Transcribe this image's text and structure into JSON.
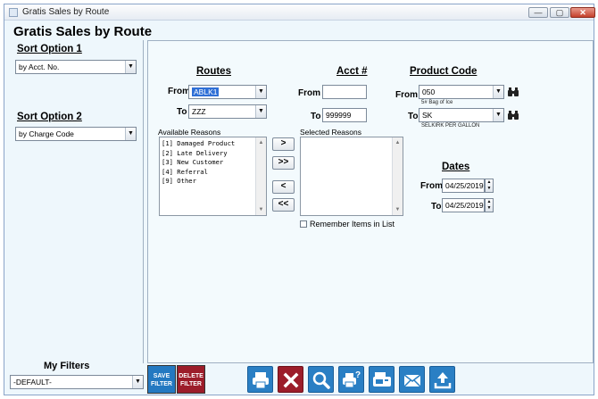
{
  "window": {
    "title": "Gratis Sales by Route",
    "minimize": "—",
    "maximize": "▢",
    "close": "✕"
  },
  "heading": "Gratis Sales by Route",
  "sort1": {
    "label": "Sort Option 1",
    "value": "by Acct. No."
  },
  "sort2": {
    "label": "Sort Option 2",
    "value": "by Charge Code"
  },
  "routes": {
    "label": "Routes",
    "from_label": "From",
    "from_value": "ABLK1",
    "to_label": "To",
    "to_value": "ZZZ"
  },
  "acct": {
    "label": "Acct #",
    "from_label": "From",
    "from_value": "",
    "to_label": "To",
    "to_value": "999999"
  },
  "product": {
    "label": "Product Code",
    "from_label": "From",
    "from_value": "050",
    "from_desc": "5# Bag of Ice",
    "to_label": "To",
    "to_value": "SK",
    "to_desc": "SELKIRK PER GALLON"
  },
  "reasons": {
    "available_label": "Available Reasons",
    "selected_label": "Selected Reasons",
    "available": [
      "[1] Damaged Product",
      "[2] Late Delivery",
      "[3] New Customer",
      "[4] Referral",
      "[9] Other"
    ],
    "add_one": ">",
    "add_all": ">>",
    "remove_one": "<",
    "remove_all": "<<",
    "remember_label": "Remember Items in List"
  },
  "dates": {
    "label": "Dates",
    "from_label": "From",
    "from_value": "04/25/2019",
    "to_label": "To",
    "to_value": "04/25/2019"
  },
  "filters": {
    "label": "My Filters",
    "value": "-DEFAULT-",
    "save_label": "SAVE FILTER",
    "delete_label": "DELETE FILTER"
  },
  "icons": [
    "printer-icon",
    "close-x-icon",
    "magnifier-icon",
    "print-help-icon",
    "fax-icon",
    "email-icon",
    "upload-icon"
  ],
  "colors": {
    "accent_blue": "#2a7fc4",
    "delete_red": "#9c1d2a",
    "save_blue": "#2479c1",
    "selection": "#2f6fd6"
  }
}
